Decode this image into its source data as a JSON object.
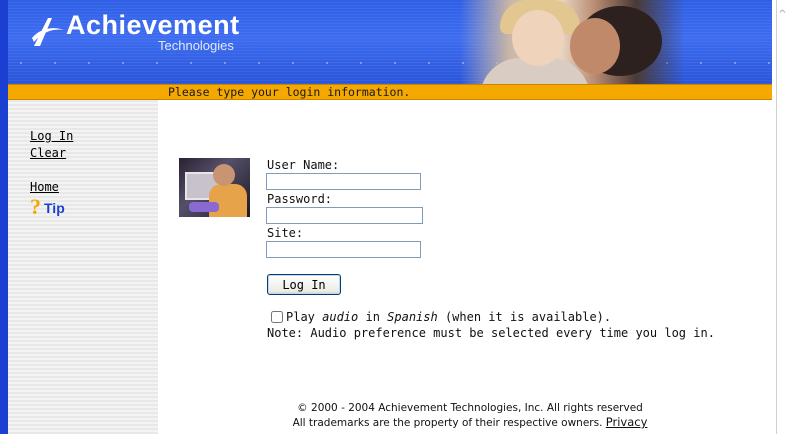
{
  "brand": {
    "title": "Achievement",
    "subtitle": "Technologies"
  },
  "status_bar": {
    "message": "Please type your login information."
  },
  "sidebar": {
    "links": [
      {
        "label": "Log In"
      },
      {
        "label": "Clear"
      },
      {
        "label": "Home"
      }
    ],
    "tip": {
      "q": "?",
      "label": "Tip"
    }
  },
  "form": {
    "username_label": "User Name:",
    "username_value": "",
    "password_label": "Password:",
    "password_value": "",
    "site_label": "Site:",
    "site_value": "",
    "submit_label": "Log In",
    "audio_checked": false,
    "audio_prefix": "Play ",
    "audio_word": "audio",
    "audio_in": " in ",
    "audio_lang": "Spanish",
    "audio_suffix": " (when it is available).",
    "note": "Note: Audio preference must be selected every time you log in."
  },
  "footer": {
    "copyright": "© 2000 - 2004 Achievement Technologies, Inc. All rights reserved",
    "trademarks": "All trademarks are the property of their respective owners.",
    "privacy_link": "Privacy"
  },
  "colors": {
    "banner_blue": "#2f5fe6",
    "status_orange": "#f5a800",
    "tip_blue": "#1b3fd1"
  }
}
